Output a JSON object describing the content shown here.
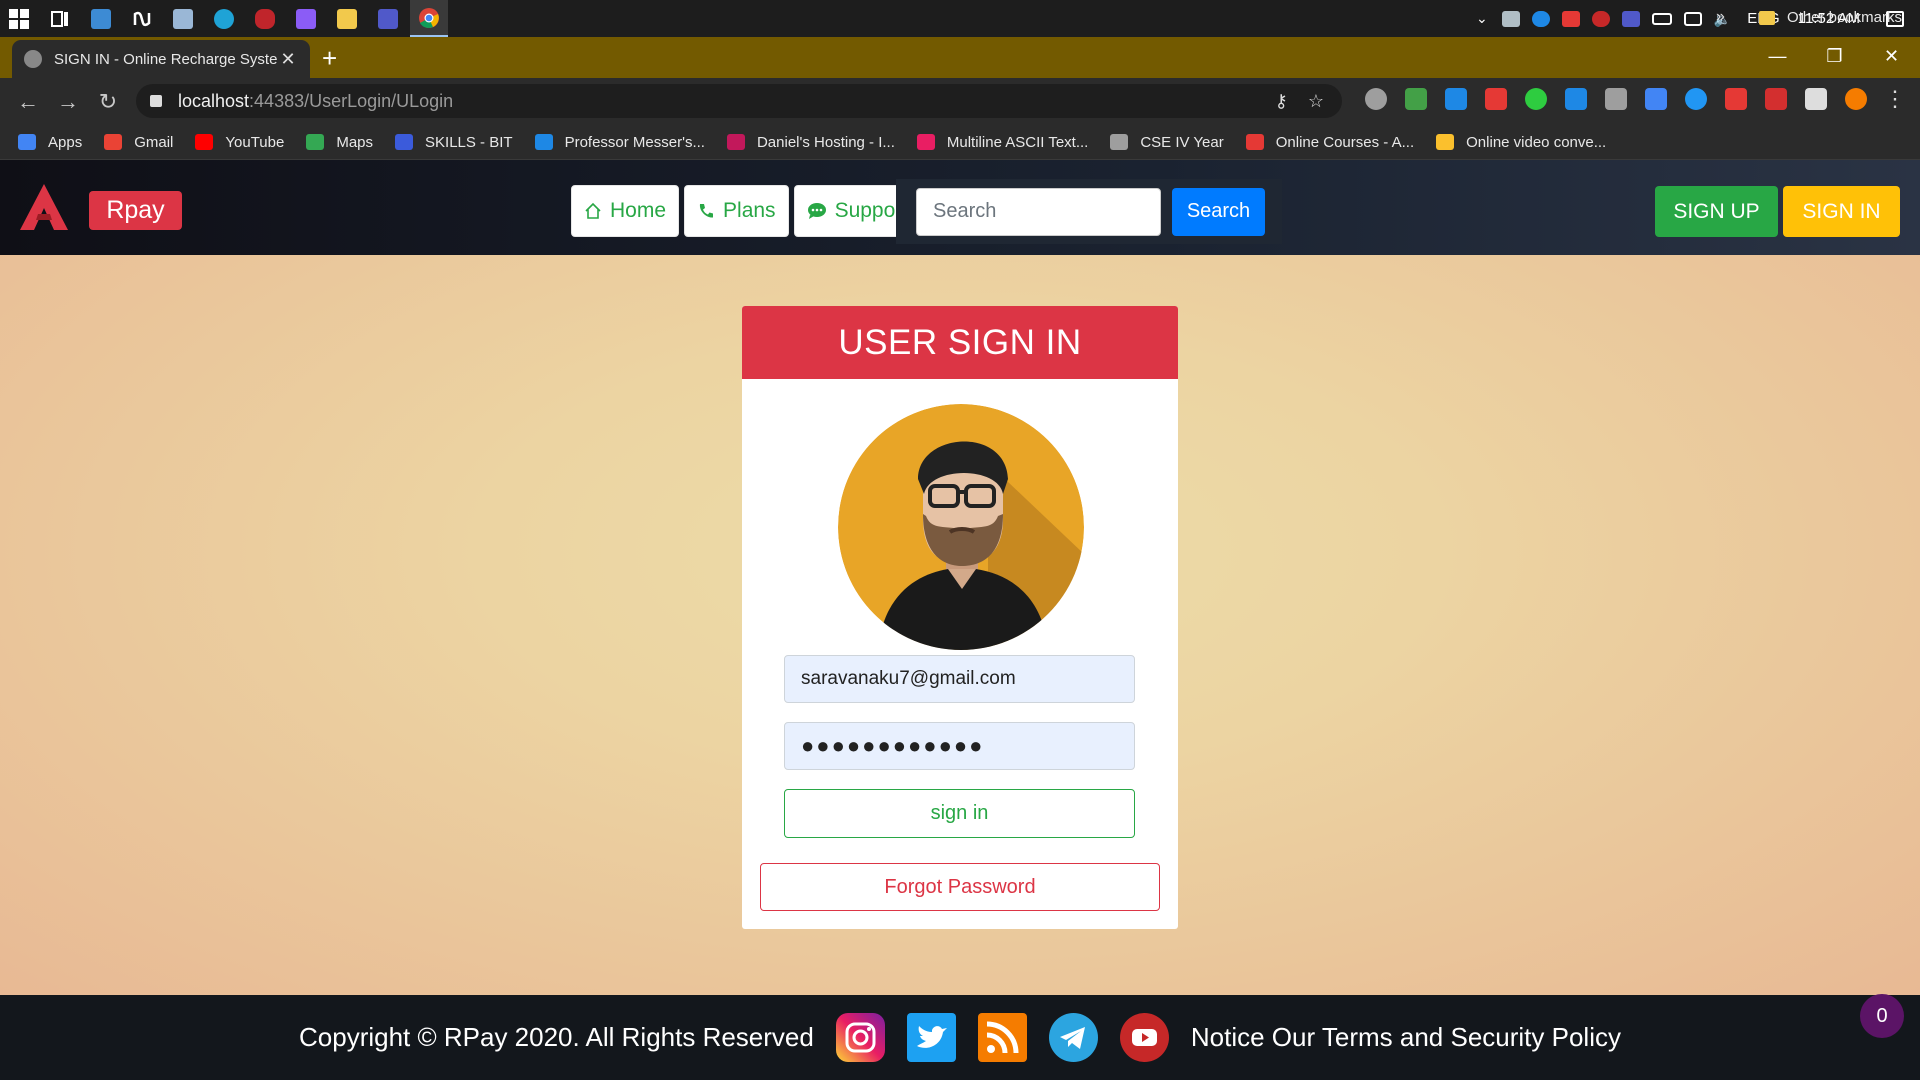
{
  "taskbar": {
    "apps": [
      "windows-start",
      "task-view",
      "terminal",
      "notion",
      "photos",
      "edge",
      "app-red",
      "visual-studio",
      "file-explorer",
      "teams",
      "chrome"
    ],
    "tray": {
      "language": "ENG",
      "time": "11:52 AM"
    }
  },
  "browser": {
    "tab_title": "SIGN IN - Online Recharge System",
    "url_host": "localhost",
    "url_path": ":44383/UserLogin/ULogin",
    "bookmarks": [
      {
        "label": "Apps",
        "color": "#4285f4"
      },
      {
        "label": "Gmail",
        "color": "#ea4335"
      },
      {
        "label": "YouTube",
        "color": "#ff0000"
      },
      {
        "label": "Maps",
        "color": "#34a853"
      },
      {
        "label": "SKILLS - BIT",
        "color": "#3b5bdb"
      },
      {
        "label": "Professor Messer's...",
        "color": "#1e88e5"
      },
      {
        "label": "Daniel's Hosting - I...",
        "color": "#c2185b"
      },
      {
        "label": "Multiline ASCII Text...",
        "color": "#e91e63"
      },
      {
        "label": "CSE IV Year",
        "color": "#9e9e9e"
      },
      {
        "label": "Online Courses - A...",
        "color": "#e53935"
      },
      {
        "label": "Online video conve...",
        "color": "#fbc02d"
      }
    ],
    "more": "»",
    "other_bookmarks": "Other bookmarks"
  },
  "site": {
    "brand": "Rpay",
    "nav": [
      {
        "label": "Home",
        "icon": "home-icon"
      },
      {
        "label": "Plans",
        "icon": "phone-icon"
      },
      {
        "label": "Support",
        "icon": "chat-icon"
      }
    ],
    "search_placeholder": "Search",
    "search_button": "Search",
    "signup": "SIGN UP",
    "signin": "SIGN IN"
  },
  "login": {
    "heading": "USER SIGN IN",
    "email_value": "saravanaku7@gmail.com",
    "password_mask": "●●●●●●●●●●●●",
    "submit": "sign in",
    "forgot": "Forgot Password"
  },
  "footer": {
    "copyright": "Copyright © RPay 2020. All Rights Reserved",
    "social": [
      "instagram-icon",
      "twitter-icon",
      "rss-icon",
      "telegram-icon",
      "youtube-icon"
    ],
    "notice": "Notice Our Terms and Security Policy",
    "badge": "0"
  },
  "colors": {
    "primary_red": "#dc3545",
    "success_green": "#28a745",
    "warning_yellow": "#ffc107",
    "info_blue": "#007bff"
  }
}
